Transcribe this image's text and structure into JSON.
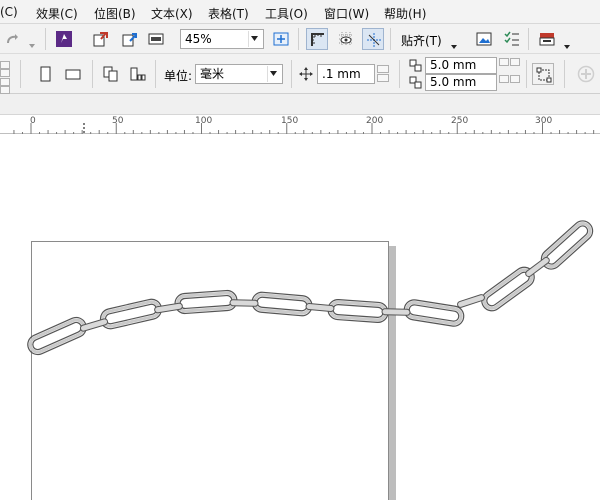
{
  "menu": {
    "items": [
      "(C)",
      "效果(C)",
      "位图(B)",
      "文本(X)",
      "表格(T)",
      "工具(O)",
      "窗口(W)",
      "帮助(H)"
    ]
  },
  "toolbar": {
    "zoom_value": "45%",
    "snap_label": "贴齐(T)"
  },
  "property_bar": {
    "unit_label": "单位:",
    "unit_value": "毫米",
    "nudge_value": ".1 mm",
    "duplicate_x": "5.0 mm",
    "duplicate_y": "5.0 mm"
  },
  "ruler": {
    "labels": [
      "0",
      "50",
      "100",
      "150",
      "200",
      "250",
      "300"
    ]
  },
  "colors": {
    "accent_blue": "#1f6fd1",
    "brand_purple": "#5b2a86",
    "chain_stroke": "#555555",
    "page_shadow": "#bdbdbd"
  }
}
